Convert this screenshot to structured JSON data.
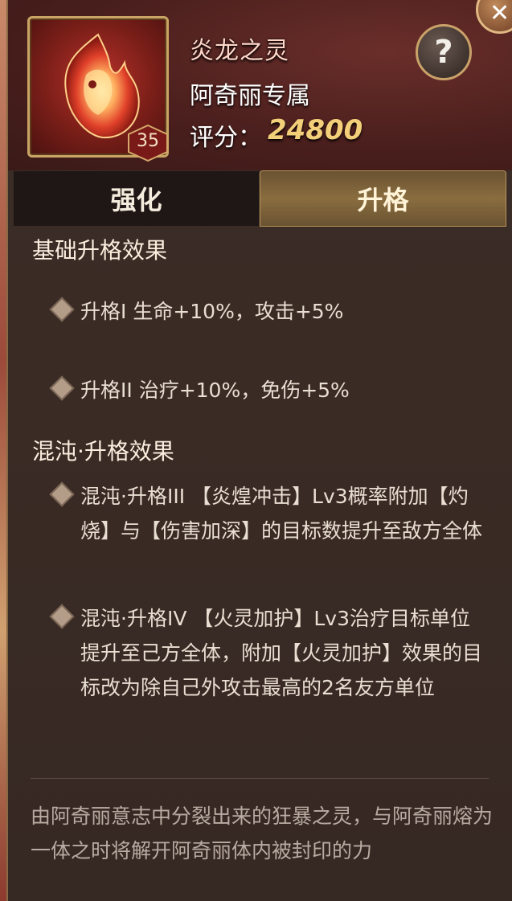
{
  "item": {
    "name": "炎龙之灵",
    "owner": "阿奇丽专属",
    "score_label": "评分：",
    "score_value": "24800",
    "level": "35"
  },
  "header": {
    "help_label": "?",
    "close_label": "✕"
  },
  "tabs": [
    {
      "label": "强化",
      "active": false
    },
    {
      "label": "升格",
      "active": true
    }
  ],
  "basic_section": {
    "title": "基础升格效果",
    "effects": [
      "升格I   生命+10%，攻击+5%",
      "升格II   治疗+10%，免伤+5%"
    ]
  },
  "chaos_section": {
    "title": "混沌·升格效果",
    "effects": [
      "混沌·升格III   【炎煌冲击】Lv3概率附加【灼烧】与【伤害加深】的目标数提升至敌方全体",
      "混沌·升格IV   【火灵加护】Lv3治疗目标单位提升至己方全体，附加【火灵加护】效果的目标改为除自己外攻击最高的2名友方单位"
    ]
  },
  "lore": "由阿奇丽意志中分裂出来的狂暴之灵，与阿奇丽熔为一体之时将解开阿奇丽体内被封印的力",
  "colors": {
    "accent_gold": "#f3cf7a",
    "title_pink": "#ffd6c8",
    "frame_gold": "#caa465"
  }
}
